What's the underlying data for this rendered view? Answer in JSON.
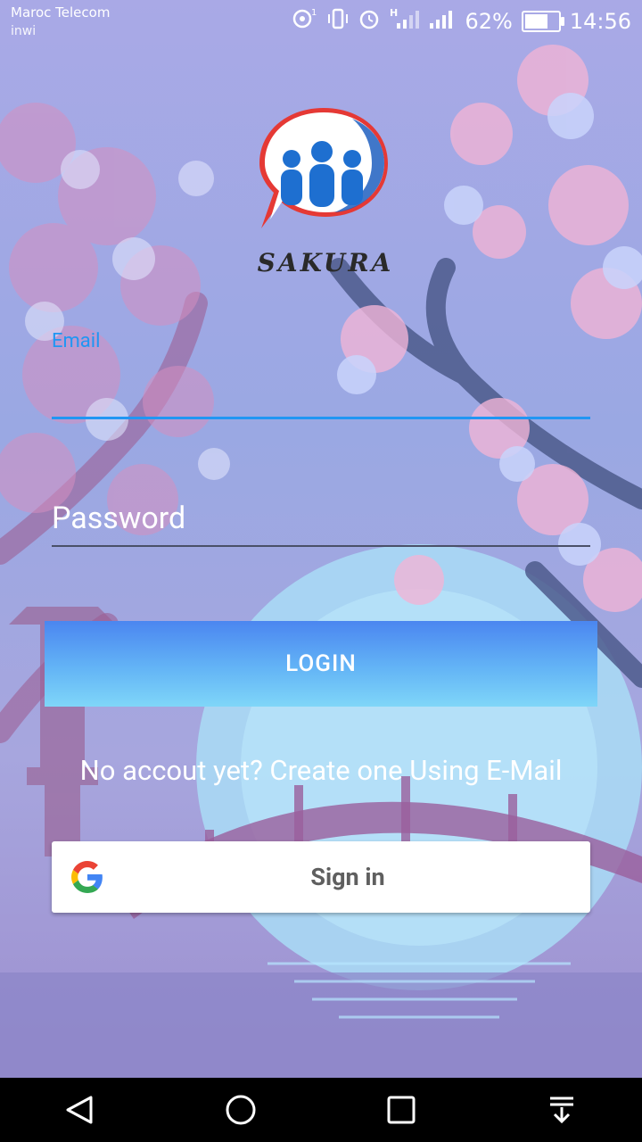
{
  "status_bar": {
    "carrier_primary": "Maroc Telecom",
    "carrier_secondary": "inwi",
    "battery_percent": "62%",
    "time": "14:56",
    "icons": [
      "hotspot-icon",
      "vibrate-icon",
      "alarm-icon",
      "signal-h-icon",
      "signal-icon",
      "battery-icon"
    ]
  },
  "app": {
    "brand_name": "SAKURA",
    "logo_colors": {
      "red": "#e53935",
      "blue": "#1e6fd0"
    }
  },
  "form": {
    "email_label": "Email",
    "password_placeholder": "Password",
    "login_label": "LOGIN",
    "create_account_text": "No accout yet? Create one Using E-Mail",
    "google_signin_label": "Sign in"
  },
  "nav_bar": {
    "icons": [
      "back-icon",
      "home-icon",
      "recents-icon",
      "notifications-pull-icon"
    ]
  },
  "colors": {
    "accent": "#2196f3",
    "login_gradient_top": "#4b86f0",
    "login_gradient_bottom": "#7fd6f8"
  }
}
